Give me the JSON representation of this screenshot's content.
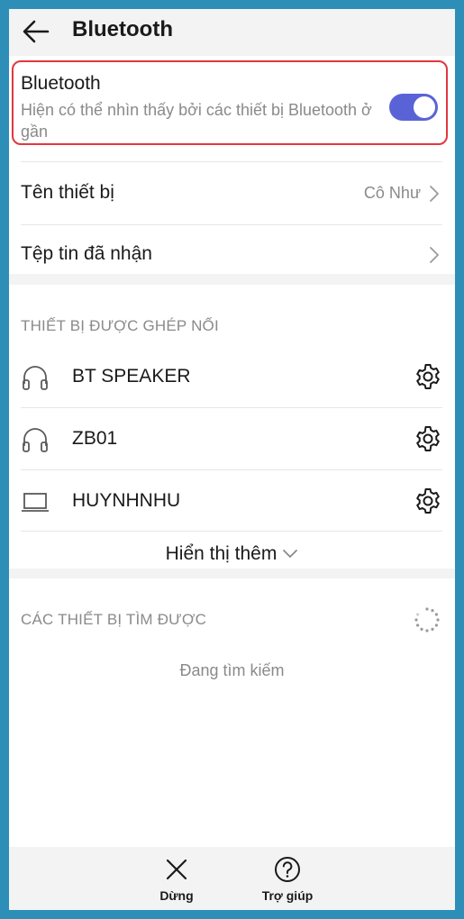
{
  "header": {
    "title": "Bluetooth"
  },
  "bluetooth": {
    "title": "Bluetooth",
    "description": "Hiện có thể nhìn thấy bởi các thiết bị Bluetooth ở gần",
    "enabled": true,
    "toggle_color": "#5a63d6",
    "highlight_color": "#e2373f"
  },
  "settings": {
    "device_name_label": "Tên thiết bị",
    "device_name_value": "Cô Như",
    "received_files_label": "Tệp tin đã nhận"
  },
  "paired": {
    "header": "THIẾT BỊ ĐƯỢC GHÉP NỐI",
    "devices": [
      {
        "name": "BT SPEAKER",
        "icon": "headphones-icon"
      },
      {
        "name": "ZB01",
        "icon": "headphones-icon"
      },
      {
        "name": "HUYNHNHU",
        "icon": "laptop-icon"
      }
    ],
    "show_more_label": "Hiển thị thêm"
  },
  "available": {
    "header": "CÁC THIẾT BỊ TÌM ĐƯỢC",
    "status": "Đang tìm kiếm"
  },
  "bottom_bar": {
    "stop_label": "Dừng",
    "help_label": "Trợ giúp"
  }
}
